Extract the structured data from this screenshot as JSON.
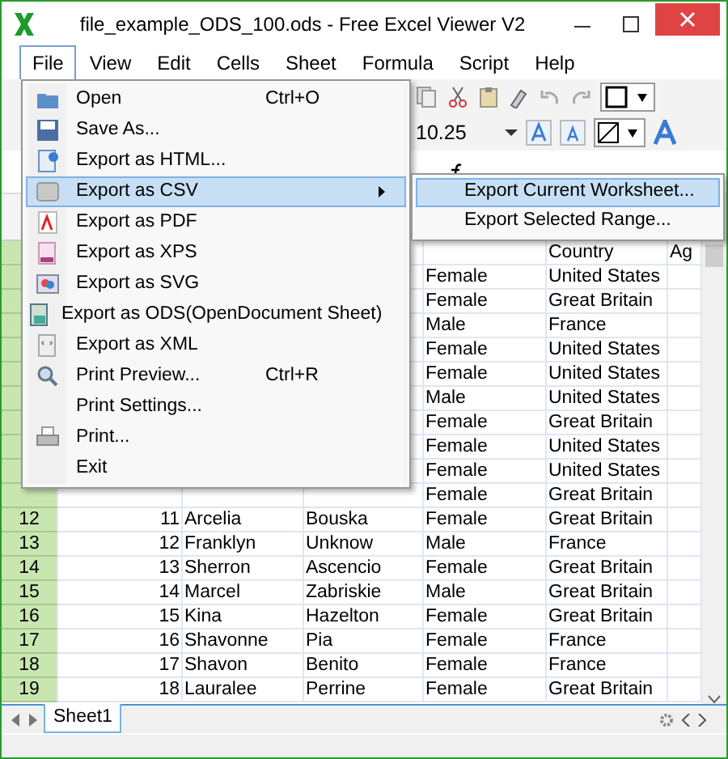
{
  "window": {
    "title": "file_example_ODS_100.ods - Free Excel Viewer V2"
  },
  "menu_bar": [
    {
      "label": "File",
      "selected": true
    },
    {
      "label": "View",
      "selected": false
    },
    {
      "label": "Edit",
      "selected": false
    },
    {
      "label": "Cells",
      "selected": false
    },
    {
      "label": "Sheet",
      "selected": false
    },
    {
      "label": "Formula",
      "selected": false
    },
    {
      "label": "Script",
      "selected": false
    },
    {
      "label": "Help",
      "selected": false
    }
  ],
  "toolbar": {
    "font_size": "10.25"
  },
  "file_menu": [
    {
      "label": "Open",
      "shortcut": "Ctrl+O",
      "submenu": false,
      "selected": false
    },
    {
      "label": "Save As...",
      "submenu": false,
      "selected": false
    },
    {
      "label": "Export as HTML...",
      "submenu": false,
      "selected": false
    },
    {
      "label": "Export as CSV",
      "submenu": true,
      "selected": true
    },
    {
      "label": "Export as PDF",
      "submenu": false,
      "selected": false
    },
    {
      "label": "Export as XPS",
      "submenu": false,
      "selected": false
    },
    {
      "label": "Export as SVG",
      "submenu": false,
      "selected": false
    },
    {
      "label": "Export as ODS(OpenDocument Sheet)",
      "submenu": false,
      "selected": false
    },
    {
      "label": "Export as XML",
      "submenu": false,
      "selected": false
    },
    {
      "label": "Print Preview...",
      "shortcut": "Ctrl+R",
      "submenu": false,
      "selected": false
    },
    {
      "label": "Print Settings...",
      "submenu": false,
      "selected": false
    },
    {
      "label": "Print...",
      "submenu": false,
      "selected": false
    },
    {
      "label": "Exit",
      "submenu": false,
      "selected": false
    }
  ],
  "csv_submenu": [
    {
      "label": "Export Current Worksheet...",
      "selected": true
    },
    {
      "label": "Export Selected Range...",
      "selected": false
    }
  ],
  "table": {
    "rows": [
      {
        "country": "Country",
        "age": "Ag"
      },
      {
        "gender": "Female",
        "country": "United States"
      },
      {
        "gender": "Female",
        "country": "Great Britain"
      },
      {
        "gender": "Male",
        "country": "France"
      },
      {
        "gender": "Female",
        "country": "United States"
      },
      {
        "gender": "Female",
        "country": "United States"
      },
      {
        "gender": "Male",
        "country": "United States"
      },
      {
        "gender": "Female",
        "country": "Great Britain"
      },
      {
        "gender": "Female",
        "country": "United States"
      },
      {
        "gender": "Female",
        "country": "United States"
      },
      {
        "gender": "Female",
        "country": "Great Britain"
      },
      {
        "number": "12",
        "id": "11",
        "first_name": "Arcelia",
        "last_name": "Bouska",
        "gender": "Female",
        "country": "Great Britain"
      },
      {
        "number": "13",
        "id": "12",
        "first_name": "Franklyn",
        "last_name": "Unknow",
        "gender": "Male",
        "country": "France"
      },
      {
        "number": "14",
        "id": "13",
        "first_name": "Sherron",
        "last_name": "Ascencio",
        "gender": "Female",
        "country": "Great Britain"
      },
      {
        "number": "15",
        "id": "14",
        "first_name": "Marcel",
        "last_name": "Zabriskie",
        "gender": "Male",
        "country": "Great Britain"
      },
      {
        "number": "16",
        "id": "15",
        "first_name": "Kina",
        "last_name": "Hazelton",
        "gender": "Female",
        "country": "Great Britain"
      },
      {
        "number": "17",
        "id": "16",
        "first_name": "Shavonne",
        "last_name": "Pia",
        "gender": "Female",
        "country": "France"
      },
      {
        "number": "18",
        "id": "17",
        "first_name": "Shavon",
        "last_name": "Benito",
        "gender": "Female",
        "country": "France"
      },
      {
        "number": "19",
        "id": "18",
        "first_name": "Lauralee",
        "last_name": "Perrine",
        "gender": "Female",
        "country": "Great Britain"
      }
    ]
  },
  "sheet_tabs": [
    {
      "label": "Sheet1",
      "selected": true
    }
  ]
}
